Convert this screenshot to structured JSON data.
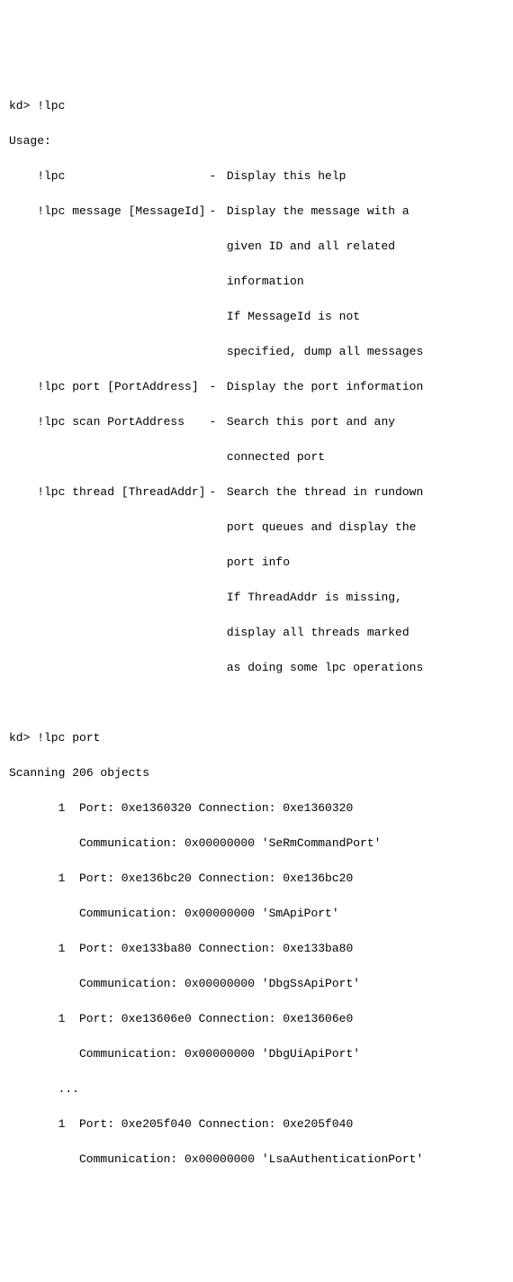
{
  "prompt1": "kd> !lpc",
  "usage_header": "Usage:",
  "commands": {
    "help": {
      "cmd": "!lpc",
      "sep": "-",
      "desc1": "Display this help"
    },
    "message": {
      "cmd": "!lpc message [MessageId]",
      "sep": "-",
      "desc1": "Display the message with a",
      "desc2": "given ID and all related",
      "desc3": "information",
      "desc4": "If MessageId is not",
      "desc5": "specified, dump all messages"
    },
    "port": {
      "cmd": "!lpc port [PortAddress]",
      "sep": "-",
      "desc1": "Display the port information"
    },
    "scan": {
      "cmd": "!lpc scan PortAddress",
      "sep": "-",
      "desc1": "Search this port and any",
      "desc2": "connected port"
    },
    "thread": {
      "cmd": "!lpc thread [ThreadAddr]",
      "sep": "-",
      "desc1": "Search the thread in rundown",
      "desc2": "port queues and display the",
      "desc3": "port info",
      "desc4": "If ThreadAddr is missing,",
      "desc5": "display all threads marked",
      "desc6": "as doing some lpc operations"
    }
  },
  "prompt2": "kd> !lpc port",
  "scan_header": "Scanning 206 objects",
  "ports": {
    "p1": {
      "line1": "1  Port: 0xe1360320 Connection: 0xe1360320",
      "line2": "Communication: 0x00000000 'SeRmCommandPort'"
    },
    "p2": {
      "line1": "1  Port: 0xe136bc20 Connection: 0xe136bc20",
      "line2": "Communication: 0x00000000 'SmApiPort'"
    },
    "p3": {
      "line1": "1  Port: 0xe133ba80 Connection: 0xe133ba80",
      "line2": "Communication: 0x00000000 'DbgSsApiPort'"
    },
    "p4": {
      "line1": "1  Port: 0xe13606e0 Connection: 0xe13606e0",
      "line2": "Communication: 0x00000000 'DbgUiApiPort'"
    },
    "ellipsis": "...",
    "p5": {
      "line1": "1  Port: 0xe205f040 Connection: 0xe205f040",
      "line2": "Communication: 0x00000000 'LsaAuthenticationPort'"
    }
  }
}
